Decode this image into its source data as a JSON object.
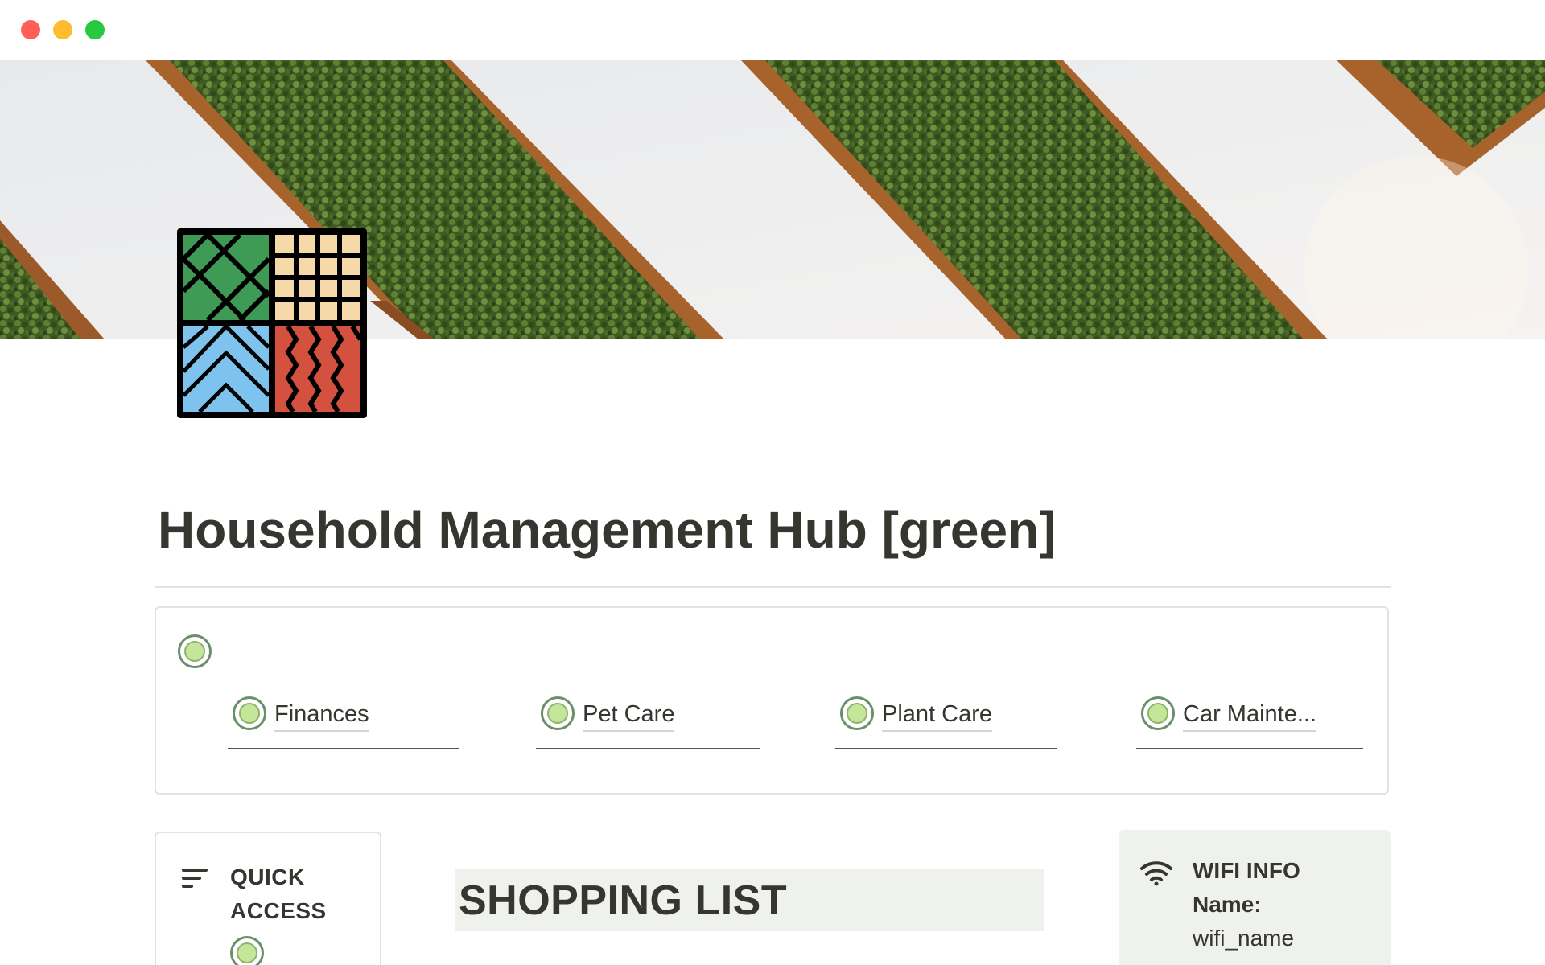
{
  "window": {
    "controls": [
      "close",
      "minimize",
      "maximize"
    ],
    "colors": {
      "close": "#ff5f57",
      "minimize": "#febc2e",
      "maximize": "#28c840"
    }
  },
  "cover": {
    "description_icon": "cover-image-green-wall-planters"
  },
  "page": {
    "icon": "house-tiles-icon",
    "title": "Household Management Hub [green]"
  },
  "nav": {
    "icon": "green-circle-icon",
    "links": [
      {
        "label": "Finances",
        "icon": "green-circle-icon"
      },
      {
        "label": "Pet Care",
        "icon": "green-circle-icon"
      },
      {
        "label": "Plant Care",
        "icon": "green-circle-icon"
      },
      {
        "label": "Car Mainte...",
        "icon": "green-circle-icon"
      }
    ]
  },
  "quick_access": {
    "title": "QUICK ACCESS",
    "icon": "menu-lines-icon"
  },
  "shopping": {
    "title": "SHOPPING LIST"
  },
  "wifi": {
    "title": "WIFI INFO",
    "name_label": "Name:",
    "name_value": "wifi_name",
    "icon": "wifi-icon"
  },
  "colors": {
    "accent_green": "#c3e69a",
    "callout_bg": "#eff2ec",
    "text": "#37352f",
    "border": "#e3e2de"
  }
}
